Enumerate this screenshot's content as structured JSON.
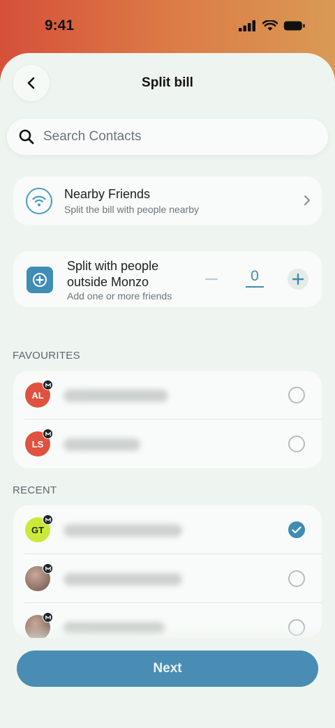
{
  "status_bar": {
    "time": "9:41"
  },
  "header": {
    "title": "Split bill"
  },
  "search": {
    "placeholder": "Search Contacts"
  },
  "nearby": {
    "title": "Nearby Friends",
    "subtitle": "Split the bill with people nearby"
  },
  "outside": {
    "title_line1": "Split with people",
    "title_line2": "outside Monzo",
    "subtitle": "Add one or more friends",
    "count": "0"
  },
  "favourites": {
    "label": "FAVOURITES",
    "contacts": [
      {
        "initials": "AL",
        "avatar_color": "#e0523f",
        "selected": false
      },
      {
        "initials": "LS",
        "avatar_color": "#e0523f",
        "selected": false
      }
    ]
  },
  "recent": {
    "label": "RECENT",
    "contacts": [
      {
        "initials": "GT",
        "avatar_color": "#c9ea3a",
        "selected": true
      },
      {
        "initials": "",
        "avatar_color": "photo",
        "selected": false
      },
      {
        "initials": "",
        "avatar_color": "photo",
        "selected": false
      }
    ]
  },
  "footer": {
    "next_label": "Next"
  },
  "colors": {
    "accent": "#3f8cb5",
    "primary_button": "#4a8db4",
    "favourite_avatar": "#e0523f",
    "recent_avatar": "#c9ea3a"
  }
}
